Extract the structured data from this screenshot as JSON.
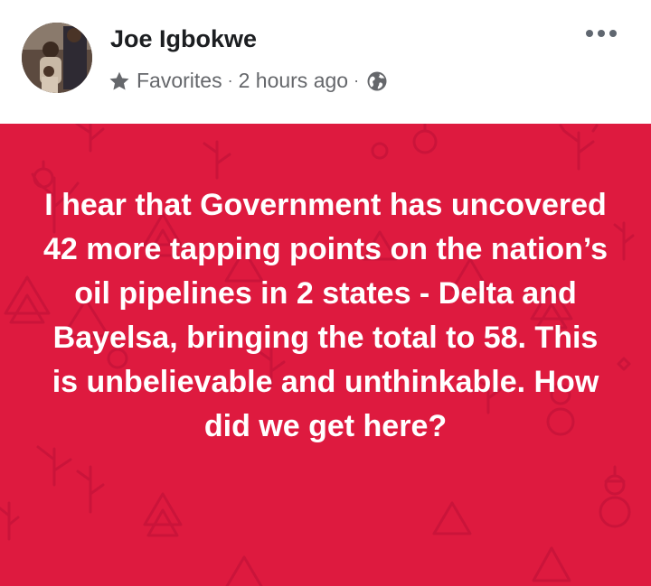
{
  "post": {
    "author": "Joe Igbokwe",
    "audience": "Favorites",
    "separator": "·",
    "time": "2 hours ago",
    "text": "I hear that Government has uncovered 42 more tapping points on the nation’s oil pipelines in 2 states - Delta and Bayelsa, bringing the total to 58. This is unbelievable and unthinkable. How did we get here?",
    "background_color": "#de1a3f",
    "text_color": "#ffffff"
  },
  "icons": {
    "avatar": "avatar",
    "audience": "star-icon",
    "privacy": "globe-icon",
    "options": "more-options-icon"
  }
}
